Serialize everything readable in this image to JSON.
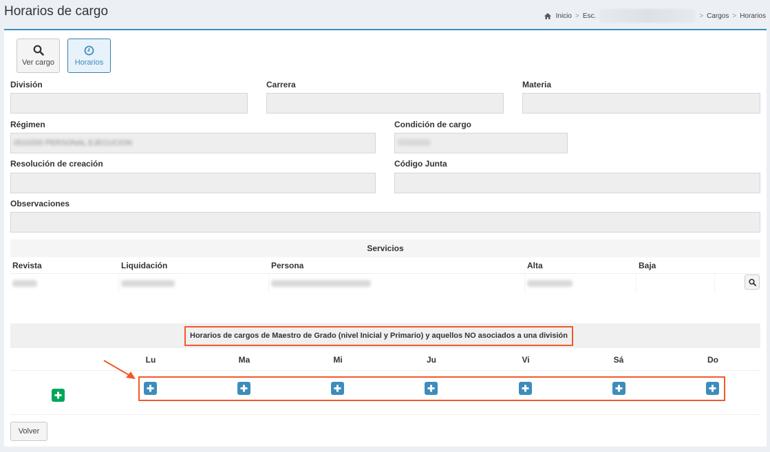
{
  "page": {
    "title": "Horarios de cargo"
  },
  "breadcrumb": {
    "items": [
      "Inicio",
      "Esc.",
      "Cargos",
      "Horarios"
    ]
  },
  "toolbar": {
    "ver_cargo": "Ver cargo",
    "horarios": "Horarios"
  },
  "form": {
    "division_label": "División",
    "division_value": "",
    "carrera_label": "Carrera",
    "carrera_value": "",
    "materia_label": "Materia",
    "materia_value": "",
    "regimen_label": "Régimen",
    "regimen_value": "0510200 PERSONAL EJECUCION",
    "condicion_label": "Condición de cargo",
    "condicion_value": "",
    "resolucion_label": "Resolución de creación",
    "resolucion_value": "",
    "codigo_label": "Código Junta",
    "codigo_value": "",
    "observaciones_label": "Observaciones",
    "observaciones_value": ""
  },
  "services": {
    "title": "Servicios",
    "columns": [
      "Revista",
      "Liquidación",
      "Persona",
      "Alta",
      "Baja"
    ]
  },
  "schedule": {
    "title": "Horarios de cargos de Maestro de Grado (nivel Inicial y Primario) y aquellos NO asociados a una división",
    "days": [
      "Lu",
      "Ma",
      "Mi",
      "Ju",
      "Vi",
      "Sá",
      "Do"
    ]
  },
  "footer": {
    "volver": "Volver"
  },
  "colors": {
    "primary": "#3c8dbc",
    "success": "#00a65a",
    "highlight": "#f05a28"
  }
}
